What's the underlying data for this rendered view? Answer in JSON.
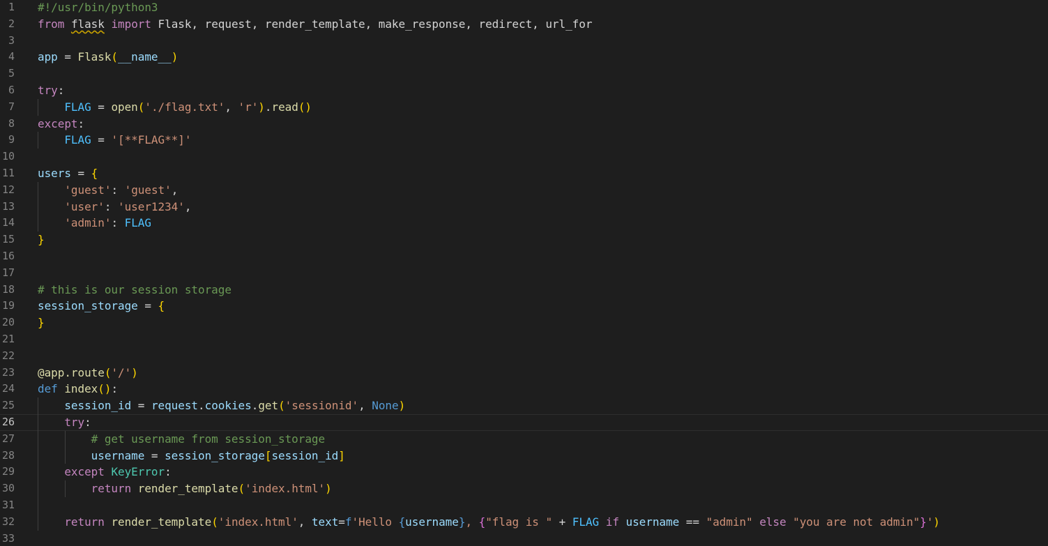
{
  "editor": {
    "current_line": 26,
    "lines": [
      {
        "n": "1",
        "tokens": [
          [
            "cmt",
            "#!/usr/bin/python3"
          ]
        ]
      },
      {
        "n": "2",
        "tokens": [
          [
            "kw",
            "from"
          ],
          [
            "pl",
            " "
          ],
          [
            "mod",
            "flask"
          ],
          [
            "pl",
            " "
          ],
          [
            "kw",
            "import"
          ],
          [
            "pl",
            " Flask, request, render_template, make_response, redirect, url_for"
          ]
        ]
      },
      {
        "n": "3",
        "tokens": []
      },
      {
        "n": "4",
        "tokens": [
          [
            "var",
            "app"
          ],
          [
            "op",
            " = "
          ],
          [
            "fn",
            "Flask"
          ],
          [
            "b1",
            "("
          ],
          [
            "var",
            "__name__"
          ],
          [
            "b1",
            ")"
          ]
        ]
      },
      {
        "n": "5",
        "tokens": []
      },
      {
        "n": "6",
        "tokens": [
          [
            "kw",
            "try"
          ],
          [
            "pl",
            ":"
          ]
        ]
      },
      {
        "n": "7",
        "tokens": [
          [
            "pl",
            "    "
          ],
          [
            "const",
            "FLAG"
          ],
          [
            "op",
            " = "
          ],
          [
            "fn",
            "open"
          ],
          [
            "b1",
            "("
          ],
          [
            "str",
            "'./flag.txt'"
          ],
          [
            "pl",
            ", "
          ],
          [
            "str",
            "'r'"
          ],
          [
            "b1",
            ")"
          ],
          [
            "pl",
            "."
          ],
          [
            "fn",
            "read"
          ],
          [
            "b1",
            "()"
          ]
        ]
      },
      {
        "n": "8",
        "tokens": [
          [
            "kw",
            "except"
          ],
          [
            "pl",
            ":"
          ]
        ]
      },
      {
        "n": "9",
        "tokens": [
          [
            "pl",
            "    "
          ],
          [
            "const",
            "FLAG"
          ],
          [
            "op",
            " = "
          ],
          [
            "str",
            "'[**FLAG**]'"
          ]
        ]
      },
      {
        "n": "10",
        "tokens": []
      },
      {
        "n": "11",
        "tokens": [
          [
            "var",
            "users"
          ],
          [
            "op",
            " = "
          ],
          [
            "b1",
            "{"
          ]
        ]
      },
      {
        "n": "12",
        "tokens": [
          [
            "pl",
            "    "
          ],
          [
            "str",
            "'guest'"
          ],
          [
            "pl",
            ": "
          ],
          [
            "str",
            "'guest'"
          ],
          [
            "pl",
            ","
          ]
        ]
      },
      {
        "n": "13",
        "tokens": [
          [
            "pl",
            "    "
          ],
          [
            "str",
            "'user'"
          ],
          [
            "pl",
            ": "
          ],
          [
            "str",
            "'user1234'"
          ],
          [
            "pl",
            ","
          ]
        ]
      },
      {
        "n": "14",
        "tokens": [
          [
            "pl",
            "    "
          ],
          [
            "str",
            "'admin'"
          ],
          [
            "pl",
            ": "
          ],
          [
            "const",
            "FLAG"
          ]
        ]
      },
      {
        "n": "15",
        "tokens": [
          [
            "b1",
            "}"
          ]
        ]
      },
      {
        "n": "16",
        "tokens": []
      },
      {
        "n": "17",
        "tokens": []
      },
      {
        "n": "18",
        "tokens": [
          [
            "cmt",
            "# this is our session storage"
          ]
        ]
      },
      {
        "n": "19",
        "tokens": [
          [
            "var",
            "session_storage"
          ],
          [
            "op",
            " = "
          ],
          [
            "b1",
            "{"
          ]
        ]
      },
      {
        "n": "20",
        "tokens": [
          [
            "b1",
            "}"
          ]
        ]
      },
      {
        "n": "21",
        "tokens": []
      },
      {
        "n": "22",
        "tokens": []
      },
      {
        "n": "23",
        "tokens": [
          [
            "fn",
            "@app.route"
          ],
          [
            "b1",
            "("
          ],
          [
            "str",
            "'/'"
          ],
          [
            "b1",
            ")"
          ]
        ]
      },
      {
        "n": "24",
        "tokens": [
          [
            "def",
            "def"
          ],
          [
            "pl",
            " "
          ],
          [
            "fn",
            "index"
          ],
          [
            "b1",
            "()"
          ],
          [
            "pl",
            ":"
          ]
        ]
      },
      {
        "n": "25",
        "tokens": [
          [
            "pl",
            "    "
          ],
          [
            "var",
            "session_id"
          ],
          [
            "op",
            " = "
          ],
          [
            "var",
            "request"
          ],
          [
            "pl",
            "."
          ],
          [
            "var",
            "cookies"
          ],
          [
            "pl",
            "."
          ],
          [
            "fn",
            "get"
          ],
          [
            "b1",
            "("
          ],
          [
            "str",
            "'sessionid'"
          ],
          [
            "pl",
            ", "
          ],
          [
            "def",
            "None"
          ],
          [
            "b1",
            ")"
          ]
        ]
      },
      {
        "n": "26",
        "tokens": [
          [
            "pl",
            "    "
          ],
          [
            "kw",
            "try"
          ],
          [
            "pl",
            ":"
          ]
        ]
      },
      {
        "n": "27",
        "tokens": [
          [
            "pl",
            "        "
          ],
          [
            "cmt",
            "# get username from session_storage"
          ]
        ]
      },
      {
        "n": "28",
        "tokens": [
          [
            "pl",
            "        "
          ],
          [
            "var",
            "username"
          ],
          [
            "op",
            " = "
          ],
          [
            "var",
            "session_storage"
          ],
          [
            "b1",
            "["
          ],
          [
            "var",
            "session_id"
          ],
          [
            "b1",
            "]"
          ]
        ]
      },
      {
        "n": "29",
        "tokens": [
          [
            "pl",
            "    "
          ],
          [
            "kw",
            "except"
          ],
          [
            "pl",
            " "
          ],
          [
            "cls",
            "KeyError"
          ],
          [
            "pl",
            ":"
          ]
        ]
      },
      {
        "n": "30",
        "tokens": [
          [
            "pl",
            "        "
          ],
          [
            "kw",
            "return"
          ],
          [
            "pl",
            " "
          ],
          [
            "fn",
            "render_template"
          ],
          [
            "b1",
            "("
          ],
          [
            "str",
            "'index.html'"
          ],
          [
            "b1",
            ")"
          ]
        ]
      },
      {
        "n": "31",
        "tokens": []
      },
      {
        "n": "32",
        "tokens": [
          [
            "pl",
            "    "
          ],
          [
            "kw",
            "return"
          ],
          [
            "pl",
            " "
          ],
          [
            "fn",
            "render_template"
          ],
          [
            "b1",
            "("
          ],
          [
            "str",
            "'index.html'"
          ],
          [
            "pl",
            ", "
          ],
          [
            "var",
            "text"
          ],
          [
            "op",
            "="
          ],
          [
            "def",
            "f"
          ],
          [
            "str",
            "'Hello "
          ],
          [
            "def",
            "{"
          ],
          [
            "var",
            "username"
          ],
          [
            "def",
            "}"
          ],
          [
            "str",
            ", "
          ],
          [
            "b2",
            "{"
          ],
          [
            "str",
            "\"flag is \""
          ],
          [
            "op",
            " + "
          ],
          [
            "const",
            "FLAG"
          ],
          [
            "pl",
            " "
          ],
          [
            "kw",
            "if"
          ],
          [
            "pl",
            " "
          ],
          [
            "var",
            "username"
          ],
          [
            "op",
            " == "
          ],
          [
            "str",
            "\"admin\""
          ],
          [
            "pl",
            " "
          ],
          [
            "kw",
            "else"
          ],
          [
            "pl",
            " "
          ],
          [
            "str",
            "\"you are not admin\""
          ],
          [
            "b2",
            "}"
          ],
          [
            "str",
            "'"
          ],
          [
            "b1",
            ")"
          ]
        ]
      },
      {
        "n": "33",
        "tokens": []
      }
    ]
  }
}
